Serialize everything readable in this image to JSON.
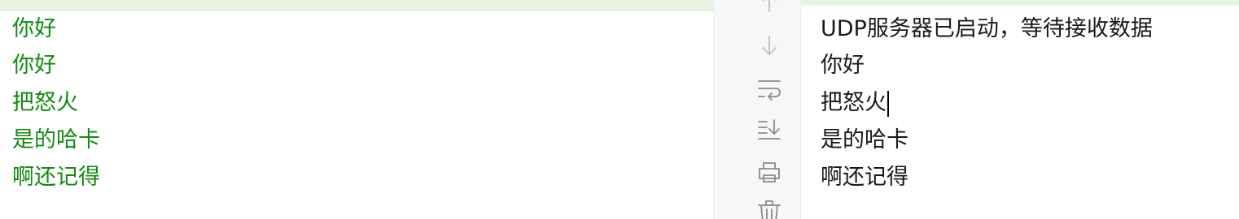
{
  "left_console": {
    "lines": [
      "你好",
      "你好",
      "把怒火",
      "是的哈卡",
      "啊还记得"
    ],
    "text_color": "#128a12"
  },
  "toolbar": {
    "icons": [
      "arrow-up-icon",
      "arrow-down-icon",
      "soft-wrap-icon",
      "scroll-to-end-icon",
      "print-icon",
      "trash-icon"
    ]
  },
  "right_console": {
    "lines": [
      "UDP服务器已启动，等待接收数据",
      "你好",
      "把怒火",
      "是的哈卡",
      "啊还记得"
    ],
    "text_color": "#1a1a1a"
  }
}
